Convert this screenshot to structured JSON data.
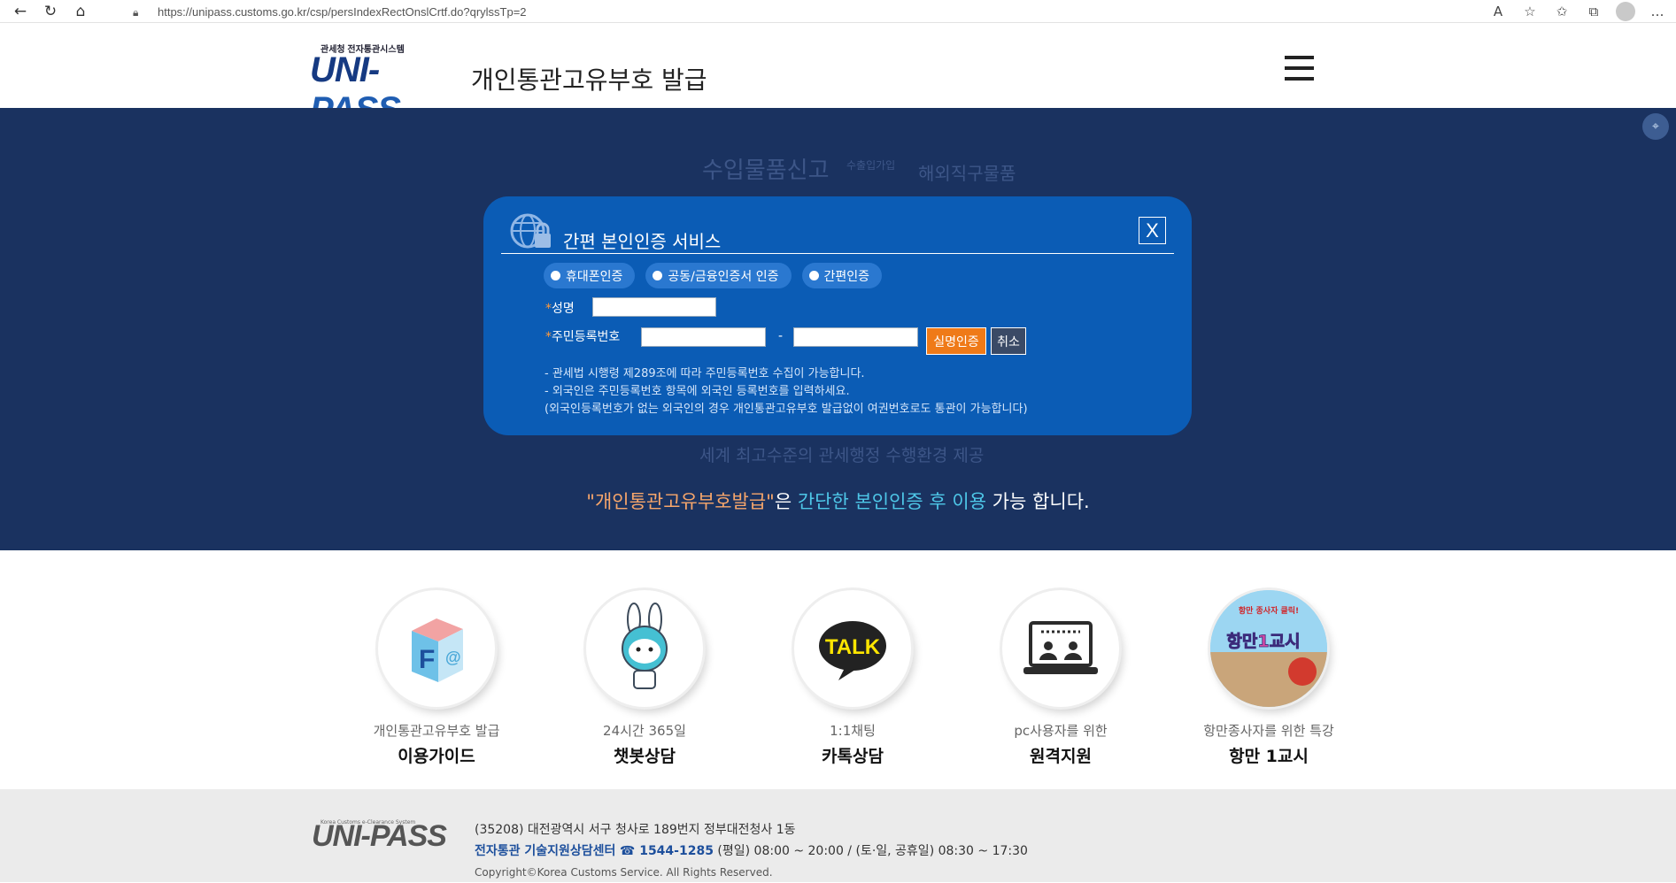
{
  "browser": {
    "url": "https://unipass.customs.go.kr/csp/persIndexRectOnslCrtf.do?qrylssTp=2",
    "icons": [
      "back-icon",
      "refresh-icon",
      "home-icon",
      "lock-icon",
      "read-aloud-icon",
      "favorite-add-icon",
      "favorites-icon",
      "collections-icon",
      "profile-icon"
    ]
  },
  "header": {
    "logo_small": "관세청 전자통관시스템",
    "logo_main_a": "UNI-",
    "logo_main_b": "PASS",
    "title": "개인통관고유부호 발급"
  },
  "hero": {
    "ghost_1": "수입물품신고",
    "ghost_1_small": "수출입가입",
    "ghost_2": "해외직구물품",
    "ghost_3": "세계 최고수준의 관세행정 수행환경 제공",
    "msg_1": "\"개인통관고유부호발급\"",
    "msg_2": "은 ",
    "msg_3": "간단한 본인인증 후 이용",
    "msg_4": " 가능 합니다."
  },
  "modal": {
    "title": "간편 본인인증 서비스",
    "close": "X",
    "radios": [
      "휴대폰인증",
      "공동/금융인증서 인증",
      "간편인증"
    ],
    "name_label": "성명",
    "rrn_label": "주민등록번호",
    "req_mark": "*",
    "dash": "-",
    "verify_btn": "실명인증",
    "cancel_btn": "취소",
    "notes": [
      "- 관세법 시행령 제289조에 따라 주민등록번호 수집이 가능합니다.",
      "- 외국인은 주민등록번호 항목에 외국인 등록번호를 입력하세요.",
      "(외국인등록번호가 없는 외국인의 경우 개인통관고유부호 발급없이 여권번호로도 통관이 가능합니다)"
    ]
  },
  "services": [
    {
      "sub": "개인통관고유부호 발급",
      "main": "이용가이드",
      "icon": "faq-cube-icon"
    },
    {
      "sub": "24시간 365일",
      "main": "챗봇상담",
      "icon": "chatbot-rabbit-icon"
    },
    {
      "sub": "1:1채팅",
      "main": "카톡상담",
      "icon": "kakao-talk-icon",
      "icon_text": "TALK"
    },
    {
      "sub": "pc사용자를 위한",
      "main": "원격지원",
      "icon": "remote-support-icon"
    },
    {
      "sub": "항만종사자를 위한 특강",
      "main": "항만 1교시",
      "icon": "port-lecture-icon",
      "icon_text": "항만1교시",
      "icon_top": "항만 종사자 클릭!"
    }
  ],
  "footer": {
    "logo": "UNI-PASS",
    "logo_small": "Korea Customs e-Clearance System",
    "address": "(35208) 대전광역시 서구 청사로 189번지 정부대전청사 1동",
    "center": "전자통관 기술지원상담센터",
    "phone": "☎ 1544-1285",
    "hours": " (평일) 08:00 ~ 20:00 / (토·일, 공휴일) 08:30 ~ 17:30",
    "copyright": "Copyright©Korea Customs Service. All Rights Reserved."
  },
  "colors": {
    "hero_bg": "#1a3260",
    "modal_bg": "#0b5cb5",
    "accent_orange": "#ef7a18",
    "accent_cyan": "#4ec7e8"
  }
}
